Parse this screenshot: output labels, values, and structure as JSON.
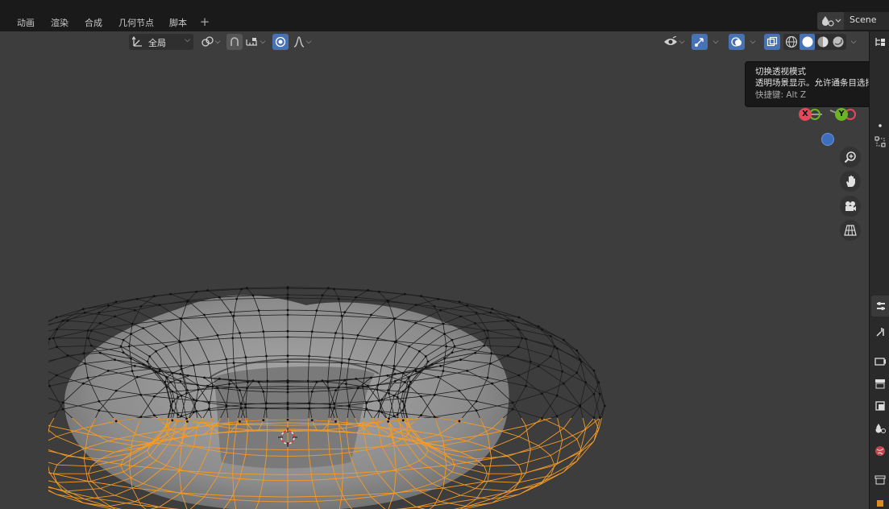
{
  "workspace_tabs": [
    {
      "label": "动画"
    },
    {
      "label": "渲染"
    },
    {
      "label": "合成"
    },
    {
      "label": "几何节点"
    },
    {
      "label": "脚本"
    }
  ],
  "scene": {
    "name": "Scene"
  },
  "viewport_header": {
    "transform_orientation": "全局"
  },
  "tooltip": {
    "title": "切换透视模式",
    "description": "透明场景显示。允许通条目选择.",
    "shortcut": "快捷键: Alt Z"
  },
  "gizmo": {
    "x_label": "X",
    "y_label": "Y",
    "x_color": "#e24a5c",
    "y_color": "#6cb423",
    "z_color": "#3e6fbf"
  },
  "colors": {
    "accent": "#4772b3",
    "selection_orange": "#f59b26",
    "viewport_bg": "#3d3d3d"
  },
  "icons": {
    "orientation": "orientation-icon",
    "pivot": "pivot-icon",
    "snap": "snap-icon",
    "snap_target": "snap-increment-icon",
    "proportional": "proportional-edit-icon",
    "falloff": "falloff-curve-icon",
    "visibility": "eye-icon",
    "gizmo_toggle": "gizmo-icon",
    "overlay": "overlay-icon",
    "xray": "xray-icon",
    "shading_wire": "wireframe-shading-icon",
    "shading_solid": "solid-shading-icon",
    "shading_material": "material-shading-icon",
    "shading_render": "rendered-shading-icon",
    "zoom": "zoom-icon",
    "pan": "hand-icon",
    "camera": "camera-icon",
    "perspective": "grid-perspective-icon"
  }
}
